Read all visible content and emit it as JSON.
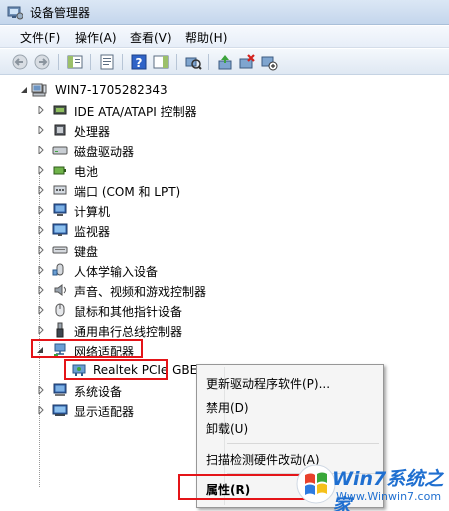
{
  "window": {
    "title": "设备管理器"
  },
  "menu": [
    "文件(F)",
    "操作(A)",
    "查看(V)",
    "帮助(H)"
  ],
  "tree": {
    "root": "WIN7-1705282343",
    "items": [
      {
        "label": "IDE ATA/ATAPI 控制器",
        "icon": "ide-controller-icon"
      },
      {
        "label": "处理器",
        "icon": "processor-icon"
      },
      {
        "label": "磁盘驱动器",
        "icon": "disk-drive-icon"
      },
      {
        "label": "电池",
        "icon": "battery-icon"
      },
      {
        "label": "端口 (COM 和 LPT)",
        "icon": "port-icon"
      },
      {
        "label": "计算机",
        "icon": "computer-icon"
      },
      {
        "label": "监视器",
        "icon": "monitor-icon"
      },
      {
        "label": "键盘",
        "icon": "keyboard-icon"
      },
      {
        "label": "人体学输入设备",
        "icon": "hid-icon"
      },
      {
        "label": "声音、视频和游戏控制器",
        "icon": "sound-icon"
      },
      {
        "label": "鼠标和其他指针设备",
        "icon": "mouse-icon"
      },
      {
        "label": "通用串行总线控制器",
        "icon": "usb-icon"
      },
      {
        "label": "网络适配器",
        "icon": "network-adapter-icon"
      },
      {
        "label": "系统设备",
        "icon": "system-device-icon"
      },
      {
        "label": "显示适配器",
        "icon": "display-adapter-icon"
      }
    ],
    "child": "Realtek PCIe GBE Family Controller"
  },
  "context_menu": {
    "items": [
      "更新驱动程序软件(P)...",
      "禁用(D)",
      "卸载(U)",
      "扫描检测硬件改动(A)",
      "属性(R)"
    ]
  },
  "watermark": {
    "brand": "Win7系统之家",
    "url": "Www.Winwin7.com"
  },
  "colors": {
    "highlight": "#e41418",
    "accent_blue": "#1f6fd0"
  }
}
